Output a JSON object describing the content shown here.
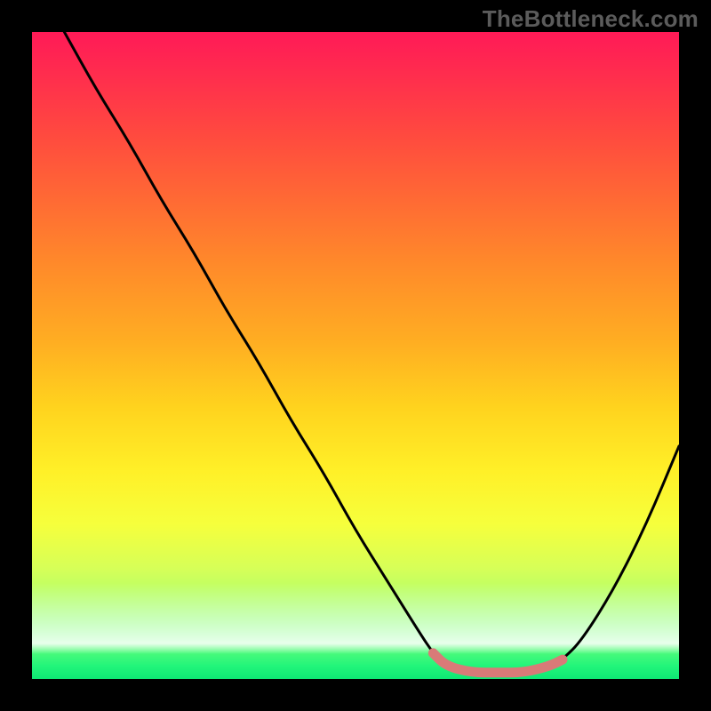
{
  "watermark": "TheBottleneck.com",
  "chart_data": {
    "type": "line",
    "title": "",
    "xlabel": "",
    "ylabel": "",
    "xlim": [
      0,
      100
    ],
    "ylim": [
      0,
      100
    ],
    "grid": false,
    "legend": false,
    "series": [
      {
        "name": "bottleneck-curve",
        "x": [
          5,
          10,
          15,
          20,
          25,
          30,
          35,
          40,
          45,
          50,
          55,
          60,
          62,
          64,
          68,
          72,
          76,
          80,
          82,
          85,
          90,
          95,
          100
        ],
        "values": [
          100,
          91,
          83,
          74,
          66,
          57,
          49,
          40,
          32,
          23,
          15,
          7,
          4,
          2,
          1,
          1,
          1,
          2,
          3,
          6,
          14,
          24,
          36
        ]
      }
    ],
    "highlight_band": {
      "name": "sweet-spot",
      "x_start": 62,
      "x_end": 82,
      "color": "#d97a78"
    },
    "notes": "V-shaped bottleneck curve over a thermal rainbow gradient. Y values are percent (100 = top of plot, 0 = bottom). Minimum plateau is around x 64–80 at y≈1. A muted red/pink band marks the sweet-spot range across the bottom."
  },
  "colors": {
    "curve": "#000000",
    "highlight": "#d97a78",
    "gradient_top": "#ff1a57",
    "gradient_bottom": "#0ee874",
    "frame": "#000000"
  }
}
